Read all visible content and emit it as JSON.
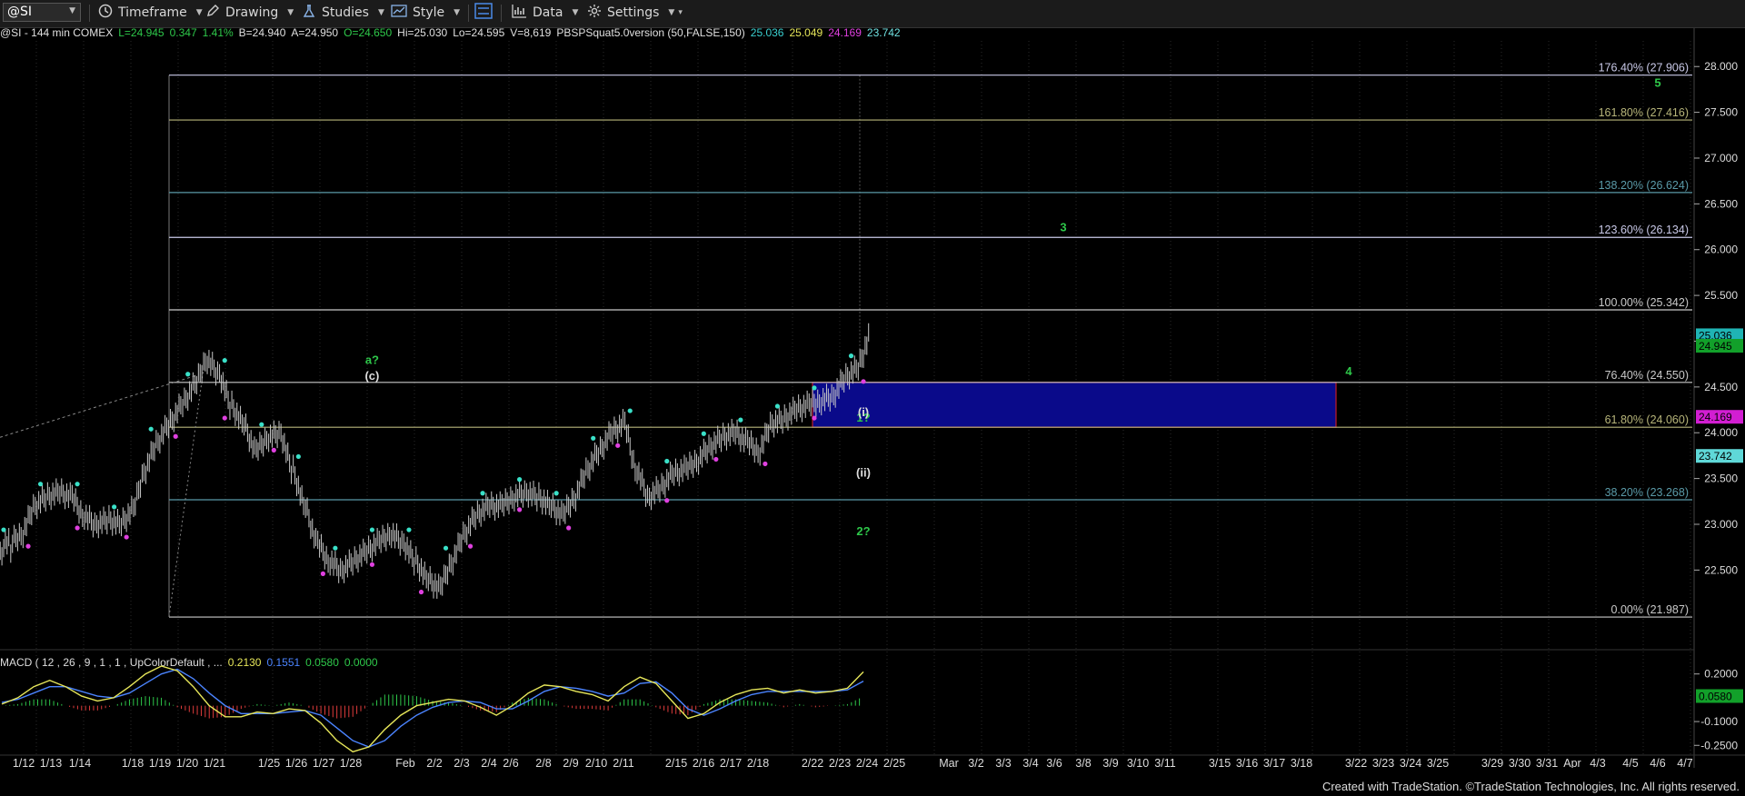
{
  "toolbar": {
    "symbol": "@SI",
    "items": [
      {
        "label": "Timeframe",
        "icon": "clock-icon"
      },
      {
        "label": "Drawing",
        "icon": "pencil-icon"
      },
      {
        "label": "Studies",
        "icon": "flask-icon"
      },
      {
        "label": "Style",
        "icon": "chart-style-icon"
      },
      {
        "label": "",
        "icon": "layout-icon"
      },
      {
        "label": "Data",
        "icon": "bar-chart-icon"
      },
      {
        "label": "Settings",
        "icon": "gear-icon"
      }
    ]
  },
  "header": {
    "segments": [
      {
        "text": "@SI - 144 min  COMEX",
        "color": "#e0e0e0"
      },
      {
        "text": "L=24.945",
        "color": "#2ec84a"
      },
      {
        "text": "0.347",
        "color": "#2ec84a"
      },
      {
        "text": "1.41%",
        "color": "#2ec84a"
      },
      {
        "text": "B=24.940",
        "color": "#e0e0e0"
      },
      {
        "text": "A=24.950",
        "color": "#e0e0e0"
      },
      {
        "text": "O=24.650",
        "color": "#2ec84a"
      },
      {
        "text": "Hi=25.030",
        "color": "#e0e0e0"
      },
      {
        "text": "Lo=24.595",
        "color": "#e0e0e0"
      },
      {
        "text": "V=8,619",
        "color": "#e0e0e0"
      },
      {
        "text": "PBSPSquat5.0version (50,FALSE,150)",
        "color": "#e0e0e0"
      },
      {
        "text": "25.036",
        "color": "#3ad0d0"
      },
      {
        "text": "25.049",
        "color": "#e6e65a"
      },
      {
        "text": "24.169",
        "color": "#e040e0"
      },
      {
        "text": "23.742",
        "color": "#6fe0e0"
      }
    ]
  },
  "chart_data": [
    {
      "type": "candlestick",
      "title": "@SI - 144 min  COMEX",
      "ylim": [
        21.65,
        28.3
      ],
      "y_ticks": [
        "22.500",
        "23.000",
        "23.500",
        "24.000",
        "24.500",
        "25.000",
        "25.500",
        "26.000",
        "26.500",
        "27.000",
        "27.500",
        "28.000"
      ],
      "x_tick_labels": [
        "1/12",
        "1/13",
        "1/14",
        "1/18",
        "1/19",
        "1/20",
        "1/21",
        "1/25",
        "1/26",
        "1/27",
        "1/28",
        "Feb",
        "2/2",
        "2/3",
        "2/4",
        "2/6",
        "2/8",
        "2/9",
        "2/10",
        "2/11",
        "2/15",
        "2/16",
        "2/17",
        "2/18",
        "2/22",
        "2/23",
        "2/24",
        "2/25",
        "Mar",
        "3/2",
        "3/3",
        "3/4",
        "3/6",
        "3/8",
        "3/9",
        "3/10",
        "3/11",
        "3/15",
        "3/16",
        "3/17",
        "3/18",
        "3/22",
        "3/23",
        "3/24",
        "3/25",
        "3/29",
        "3/30",
        "3/31",
        "Apr",
        "4/3",
        "4/5",
        "4/6",
        "4/7"
      ],
      "close_path": [
        22.8,
        22.9,
        23.2,
        23.3,
        23.35,
        23.3,
        23.1,
        23.0,
        23.05,
        23.0,
        23.15,
        23.6,
        23.9,
        24.1,
        24.3,
        24.5,
        24.8,
        24.65,
        24.3,
        24.1,
        23.8,
        23.95,
        24.0,
        23.6,
        23.2,
        22.8,
        22.6,
        22.5,
        22.6,
        22.7,
        22.8,
        22.9,
        22.8,
        22.6,
        22.4,
        22.3,
        22.6,
        22.9,
        23.1,
        23.2,
        23.2,
        23.3,
        23.35,
        23.3,
        23.2,
        23.1,
        23.3,
        23.6,
        23.8,
        24.0,
        24.1,
        23.6,
        23.3,
        23.4,
        23.55,
        23.6,
        23.7,
        23.85,
        23.95,
        24.0,
        23.9,
        23.8,
        24.1,
        24.15,
        24.25,
        24.3,
        24.35,
        24.4,
        24.6,
        24.7,
        25.036
      ],
      "last_price": 24.945,
      "marker_labels": [
        {
          "text": "a?",
          "color": "#2ec84a",
          "x": 30,
          "y": 24.75
        },
        {
          "text": "(c)",
          "color": "#dddddd",
          "x": 30,
          "y": 24.58
        },
        {
          "text": "1?",
          "color": "#2ec84a",
          "x": 104,
          "y": 24.12
        },
        {
          "text": "2?",
          "color": "#2ec84a",
          "x": 106,
          "y": 22.88
        },
        {
          "text": "(i)",
          "color": "#dddddd",
          "x": 121,
          "y": 24.18
        },
        {
          "text": "(ii)",
          "color": "#dddddd",
          "x": 126,
          "y": 23.52
        },
        {
          "text": "3",
          "color": "#2ec84a",
          "x": 178,
          "y": 26.2
        },
        {
          "text": "4",
          "color": "#2ec84a",
          "x": 232,
          "y": 24.63
        },
        {
          "text": "5",
          "color": "#2ec84a",
          "x": 285,
          "y": 27.78
        }
      ],
      "fib_levels": [
        {
          "label": "176.40% (27.906)",
          "value": 27.906,
          "color": "#c9c9e8"
        },
        {
          "label": "161.80% (27.416)",
          "value": 27.416,
          "color": "#b7b57a"
        },
        {
          "label": "138.20% (26.624)",
          "value": 26.624,
          "color": "#5a9aa8"
        },
        {
          "label": "123.60% (26.134)",
          "value": 26.134,
          "color": "#c9c9e8"
        },
        {
          "label": "100.00% (25.342)",
          "value": 25.342,
          "color": "#c9c9c9"
        },
        {
          "label": "76.40% (24.550)",
          "value": 24.55,
          "color": "#c9c9c9"
        },
        {
          "label": "61.80% (24.060)",
          "value": 24.06,
          "color": "#b7b57a"
        },
        {
          "label": "38.20% (23.268)",
          "value": 23.268,
          "color": "#5a9aa8"
        },
        {
          "label": "0.00% (21.987)",
          "value": 21.987,
          "color": "#c9c9c9"
        }
      ],
      "target_box": {
        "y_top": 24.55,
        "y_bottom": 24.06,
        "fill": "#0a0a8a",
        "border": "#c01a2a"
      },
      "price_tags": [
        {
          "text": "25.036",
          "value": 25.06,
          "bg": "#1fb4b4",
          "fg": "#000000"
        },
        {
          "text": "24.945",
          "value": 24.945,
          "bg": "#12a02a",
          "fg": "#000000"
        },
        {
          "text": "24.169",
          "value": 24.169,
          "bg": "#d21ed2",
          "fg": "#000000"
        },
        {
          "text": "23.742",
          "value": 23.742,
          "bg": "#5fd8d8",
          "fg": "#000000"
        }
      ],
      "accent_colors": {
        "up": "#2ec84a",
        "down": "#e03c3c",
        "high_dot": "#3ae0c8",
        "low_dot": "#e040e0",
        "bars": "#c9c9c9"
      }
    },
    {
      "type": "line",
      "title": "MACD ( 12 , 26 , 9 , 1 , 1 , UpColorDefault , ...",
      "values_header": [
        {
          "text": "MACD ( 12 , 26 , 9 , 1 , 1 , UpColorDefault , ...",
          "color": "#dddddd"
        },
        {
          "text": "0.2130",
          "color": "#e6e65a"
        },
        {
          "text": "0.1551",
          "color": "#4b84ff"
        },
        {
          "text": "0.0580",
          "color": "#2ec84a"
        },
        {
          "text": "0.0000",
          "color": "#2ec84a"
        }
      ],
      "ylim": [
        -0.3,
        0.33
      ],
      "y_ticks": [
        "0.2000",
        "-0.1000",
        "-0.2500"
      ],
      "zero_tag": {
        "text": "0.0580",
        "value": 0.058,
        "bg": "#12a02a"
      },
      "macd_path": [
        0.01,
        0.05,
        0.12,
        0.16,
        0.12,
        0.06,
        0.03,
        0.05,
        0.12,
        0.2,
        0.25,
        0.22,
        0.12,
        0.0,
        -0.07,
        -0.07,
        -0.04,
        -0.05,
        -0.02,
        -0.03,
        -0.11,
        -0.22,
        -0.29,
        -0.26,
        -0.15,
        -0.06,
        0.0,
        0.02,
        0.04,
        0.03,
        -0.01,
        -0.06,
        0.0,
        0.08,
        0.13,
        0.12,
        0.09,
        0.07,
        0.03,
        0.12,
        0.18,
        0.14,
        0.03,
        -0.08,
        -0.05,
        0.02,
        0.07,
        0.1,
        0.11,
        0.08,
        0.1,
        0.08,
        0.09,
        0.11,
        0.213
      ],
      "signal_path": [
        0.02,
        0.04,
        0.08,
        0.12,
        0.12,
        0.09,
        0.06,
        0.05,
        0.08,
        0.14,
        0.2,
        0.23,
        0.17,
        0.08,
        0.0,
        -0.05,
        -0.05,
        -0.05,
        -0.04,
        -0.03,
        -0.06,
        -0.14,
        -0.22,
        -0.26,
        -0.22,
        -0.13,
        -0.06,
        -0.01,
        0.02,
        0.03,
        0.02,
        -0.02,
        -0.02,
        0.03,
        0.09,
        0.12,
        0.11,
        0.09,
        0.06,
        0.08,
        0.14,
        0.15,
        0.08,
        -0.02,
        -0.06,
        -0.02,
        0.03,
        0.07,
        0.09,
        0.09,
        0.09,
        0.09,
        0.09,
        0.1,
        0.155
      ],
      "histogram_path": [
        0.0,
        0.01,
        0.04,
        0.04,
        0.0,
        -0.03,
        -0.03,
        0.0,
        0.04,
        0.06,
        0.05,
        -0.01,
        -0.05,
        -0.08,
        -0.07,
        -0.02,
        0.01,
        0.0,
        0.02,
        0.0,
        -0.05,
        -0.08,
        -0.07,
        0.0,
        0.07,
        0.07,
        0.06,
        0.03,
        0.02,
        0.0,
        -0.03,
        -0.04,
        0.02,
        0.05,
        0.04,
        0.0,
        -0.02,
        -0.02,
        -0.03,
        0.04,
        0.04,
        -0.01,
        -0.05,
        -0.06,
        0.01,
        0.04,
        0.04,
        0.03,
        0.02,
        -0.01,
        0.01,
        -0.01,
        0.0,
        0.01,
        0.058
      ]
    }
  ],
  "footer": {
    "text": "Created with TradeStation. ©TradeStation Technologies, Inc. All rights reserved."
  }
}
